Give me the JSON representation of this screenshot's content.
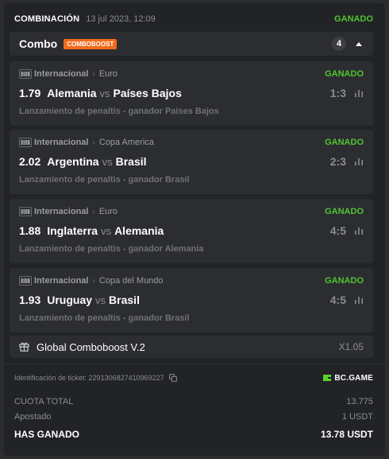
{
  "header": {
    "title": "COMBINACIÓN",
    "date": "13 jul 2023, 12:09",
    "status": "GANADO"
  },
  "combo": {
    "name": "Combo",
    "badge": "COMBOBOOST",
    "count": "4",
    "expanded": true
  },
  "bets": [
    {
      "league": "Internacional",
      "tournament": "Euro",
      "status": "GANADO",
      "odd": "1.79",
      "home": "Alemania",
      "vs": "vs",
      "away": "Países Bajos",
      "score": "1:3",
      "market": "Lanzamiento de penaltis - ganador Países Bajos",
      "icon": "fifa-icon"
    },
    {
      "league": "Internacional",
      "tournament": "Copa America",
      "status": "GANADO",
      "odd": "2.02",
      "home": "Argentina",
      "vs": "vs",
      "away": "Brasil",
      "score": "2:3",
      "market": "Lanzamiento de penaltis - ganador Brasil",
      "icon": "fifa-icon"
    },
    {
      "league": "Internacional",
      "tournament": "Euro",
      "status": "GANADO",
      "odd": "1.88",
      "home": "Inglaterra",
      "vs": "vs",
      "away": "Alemania",
      "score": "4:5",
      "market": "Lanzamiento de penaltis - ganador Alemania",
      "icon": "fifa-icon"
    },
    {
      "league": "Internacional",
      "tournament": "Copa del Mundo",
      "status": "GANADO",
      "odd": "1.93",
      "home": "Uruguay",
      "vs": "vs",
      "away": "Brasil",
      "score": "4:5",
      "market": "Lanzamiento de penaltis - ganador Brasil",
      "icon": "fifa-icon"
    }
  ],
  "boost": {
    "label": "Global Comboboost V.2",
    "multiplier": "X1.05",
    "icon": "gift-icon"
  },
  "ticket": {
    "label": "Identificación de ticket: 2291306827410969227",
    "copy_icon": "copy-icon",
    "brand": "BC.GAME"
  },
  "summary": {
    "total_odds_label": "CUOTA TOTAL",
    "total_odds_value": "13.775",
    "staked_label": "Apostado",
    "staked_value": "1 USDT",
    "won_label": "HAS GANADO",
    "won_value": "13.78 USDT"
  },
  "colors": {
    "win": "#4fc531",
    "badge": "#f26a1b",
    "brand": "#58d32c"
  }
}
